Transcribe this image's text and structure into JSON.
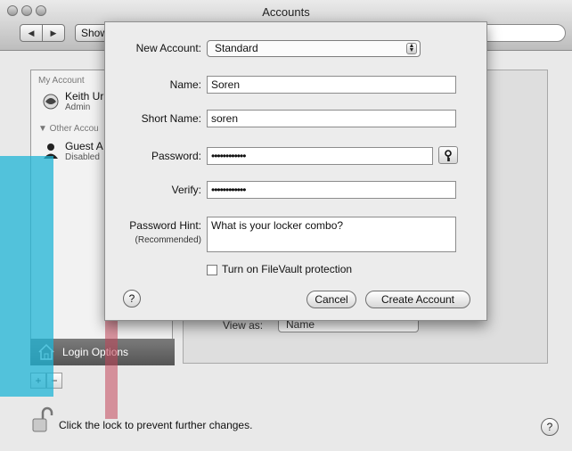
{
  "window": {
    "title": "Accounts"
  },
  "toolbar": {
    "back": "◀",
    "forward": "▶",
    "show_all_label": "Show All"
  },
  "sidebar": {
    "my_account_header": "My Account",
    "my_account": {
      "name": "Keith Ur",
      "role": "Admin"
    },
    "other_accounts_header": "▼ Other Accou",
    "guest": {
      "name": "Guest A",
      "status": "Disabled"
    },
    "login_options_label": "Login Options",
    "add_label": "+",
    "remove_label": "−"
  },
  "main": {
    "view_as_label": "View as:",
    "view_as_value": "Name"
  },
  "footer": {
    "lock_text": "Click the lock to prevent further changes.",
    "help": "?"
  },
  "sheet": {
    "new_account_label": "New Account:",
    "new_account_value": "Standard",
    "name_label": "Name:",
    "name_value": "Soren",
    "short_name_label": "Short Name:",
    "short_name_value": "soren",
    "password_label": "Password:",
    "password_value": "••••••••••••",
    "verify_label": "Verify:",
    "verify_value": "••••••••••••",
    "hint_label": "Password Hint:",
    "hint_sub_label": "(Recommended)",
    "hint_value": "What is your locker combo?",
    "filevault_label": "Turn on FileVault protection",
    "help": "?",
    "cancel_label": "Cancel",
    "create_label": "Create Account"
  }
}
